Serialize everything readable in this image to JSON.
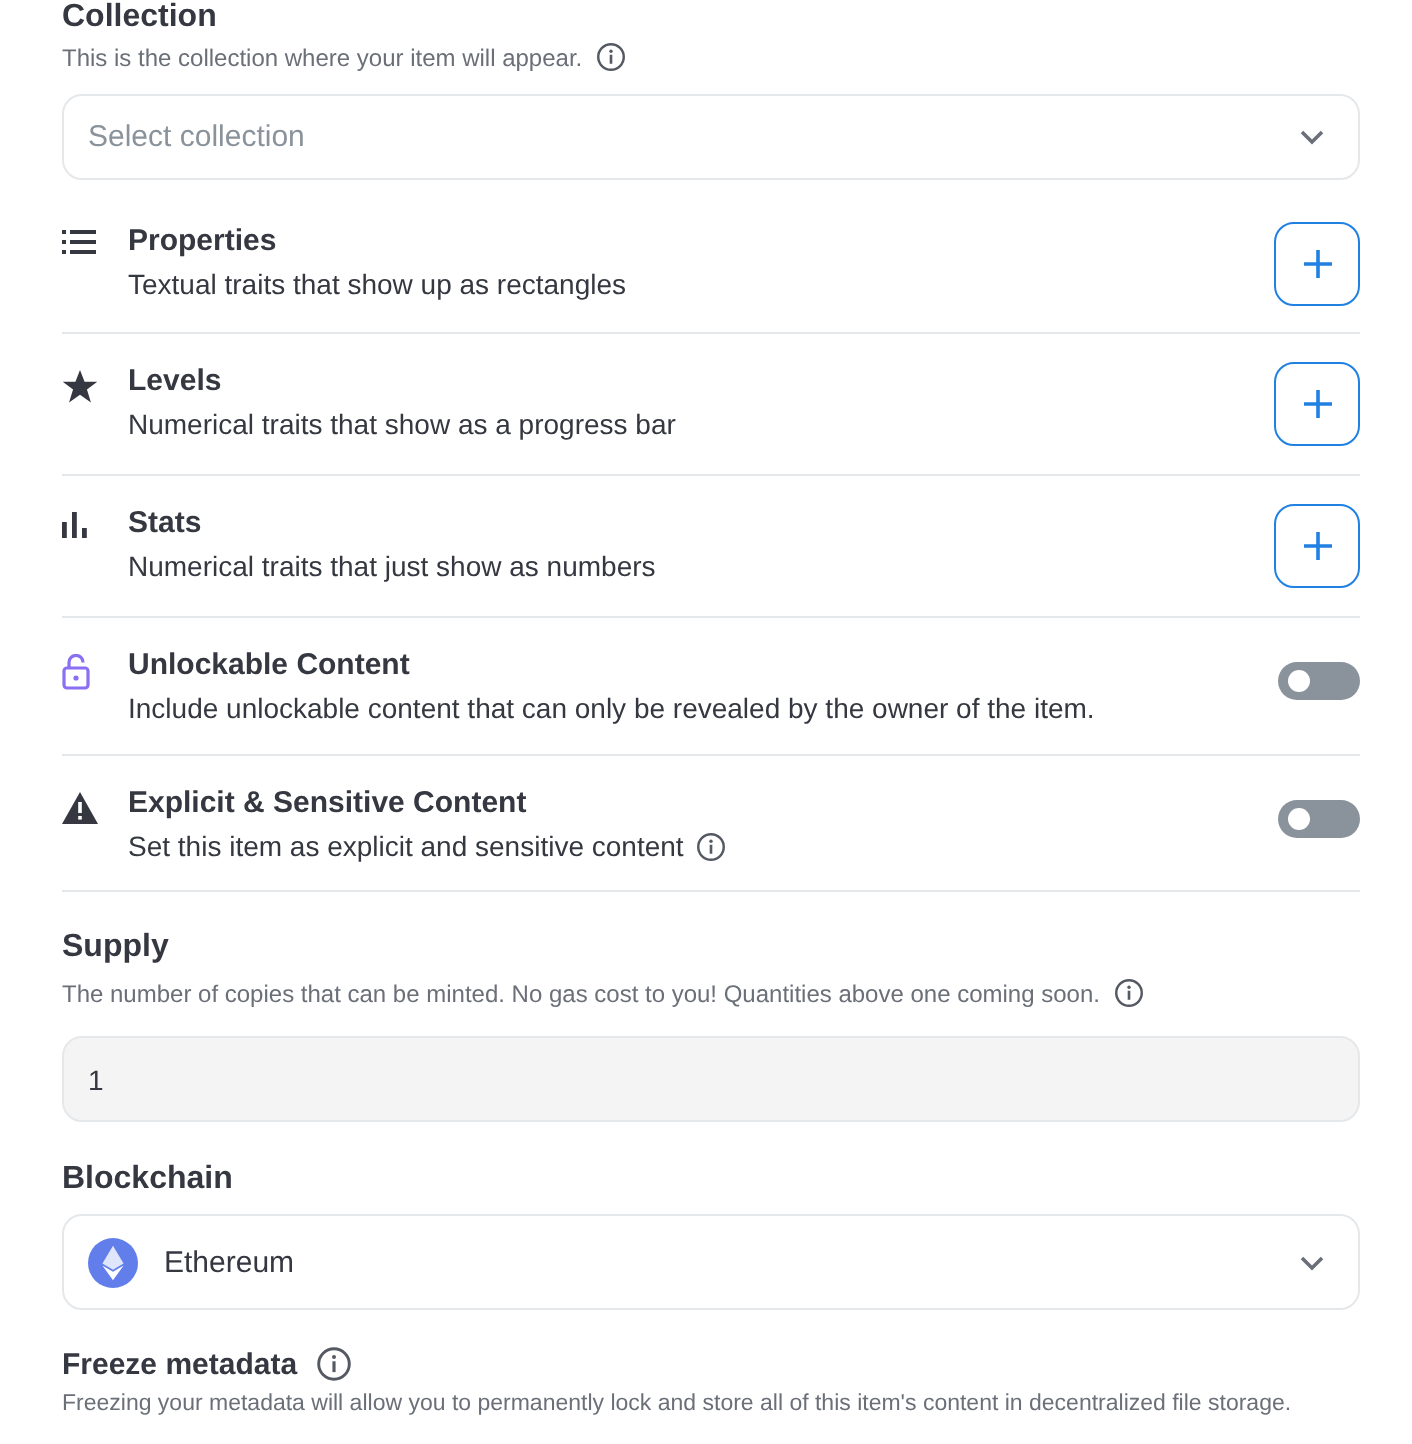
{
  "collection": {
    "title": "Collection",
    "description": "This is the collection where your item will appear.",
    "select": {
      "placeholder": "Select collection"
    }
  },
  "traits": [
    {
      "kind": "add",
      "title": "Properties",
      "description": "Textual traits that show up as rectangles",
      "info": false
    },
    {
      "kind": "add",
      "title": "Levels",
      "description": "Numerical traits that show as a progress bar",
      "info": false
    },
    {
      "kind": "add",
      "title": "Stats",
      "description": "Numerical traits that just show as numbers",
      "info": false
    },
    {
      "kind": "toggle",
      "title": "Unlockable Content",
      "description": "Include unlockable content that can only be revealed by the owner of the item.",
      "on": false,
      "info": false
    },
    {
      "kind": "toggle",
      "title": "Explicit & Sensitive Content",
      "description": "Set this item as explicit and sensitive content",
      "on": false,
      "info": true
    }
  ],
  "supply": {
    "title": "Supply",
    "description": "The number of copies that can be minted. No gas cost to you! Quantities above one coming soon.",
    "value": "1"
  },
  "blockchain": {
    "title": "Blockchain",
    "value": "Ethereum"
  },
  "freeze": {
    "title": "Freeze metadata",
    "description": "Freezing your metadata will allow you to permanently lock and store all of this item's content in decentralized file storage."
  }
}
